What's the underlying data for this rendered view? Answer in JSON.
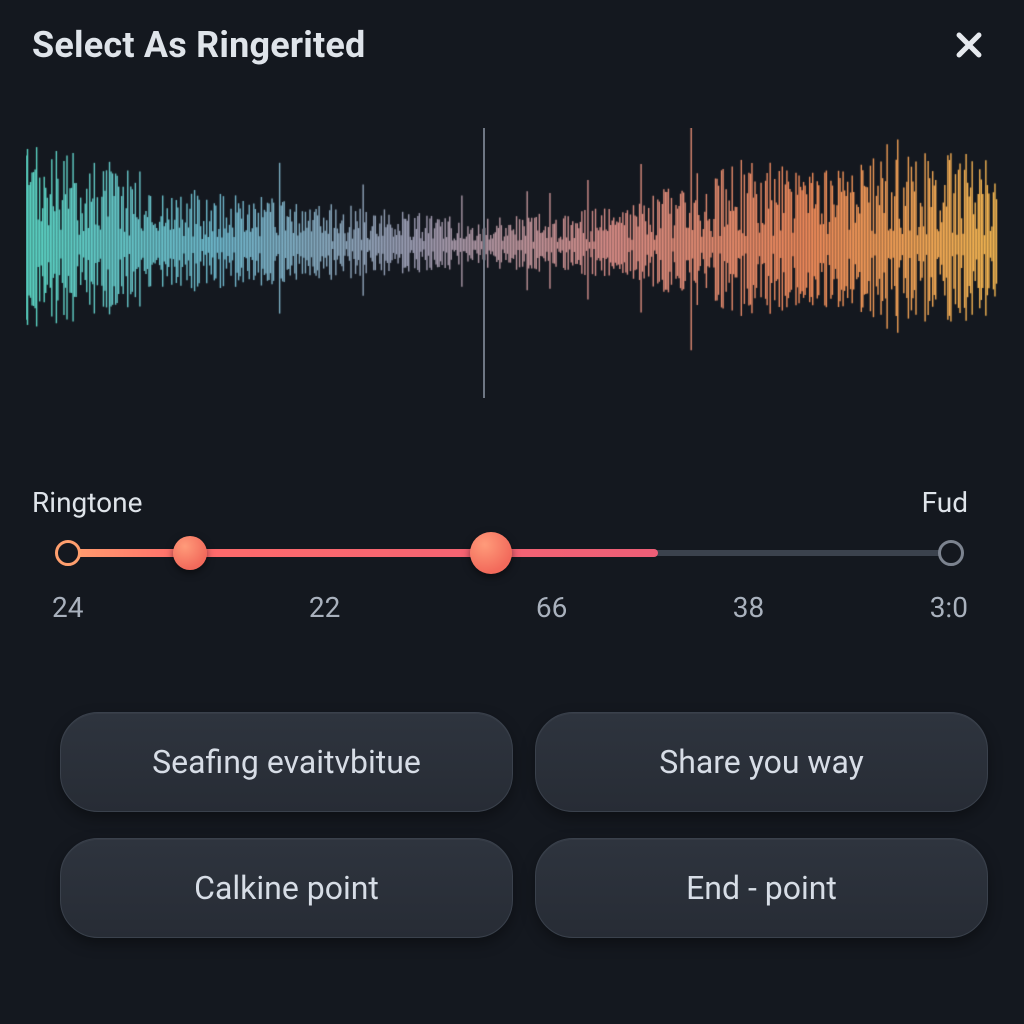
{
  "header": {
    "title": "Select As Ringerited",
    "close_icon": "close-icon"
  },
  "waveform": {
    "playhead_pct": 47,
    "gradient": [
      "#5bd6c4",
      "#6fb8cd",
      "#9a9ab0",
      "#d88c86",
      "#f08a5a",
      "#f5b851"
    ]
  },
  "slider": {
    "left_label": "Ringtone",
    "right_label": "Fud",
    "ticks": [
      "24",
      "22",
      "66",
      "38",
      "3:0"
    ],
    "start_ring_pct": 4,
    "knob1_pct": 17,
    "knob2_pct": 49,
    "fill_end_pct": 66,
    "end_ring_pct": 98
  },
  "buttons": {
    "b1": "Seafing evaitvbitue",
    "b2": "Share you way",
    "b3": "Calkine point",
    "b4": "End - point"
  }
}
